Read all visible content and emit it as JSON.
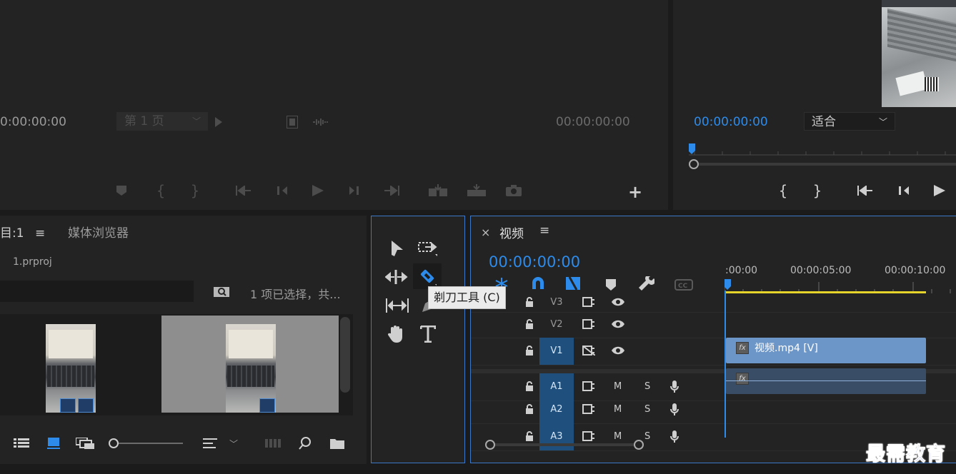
{
  "source_monitor": {
    "timecode_left": "0:00:00:00",
    "page_select": "第 1 页",
    "timecode_right": "00:00:00:00"
  },
  "program_monitor": {
    "timecode": "00:00:00:00",
    "fit_select": "适合"
  },
  "project_panel": {
    "tab_label": "目:1",
    "media_browser_tab": "媒体浏览器",
    "project_file": "1.prproj",
    "search_placeholder": "",
    "selection_status": "1 项已选择，共..."
  },
  "tools": {
    "tooltip": "剃刀工具 (C)"
  },
  "timeline": {
    "tab_label": "视频",
    "timecode": "00:00:00:00",
    "ruler": [
      ":00:00",
      "00:00:05:00",
      "00:00:10:00"
    ],
    "tracks": [
      {
        "name": "V3",
        "kind": "video"
      },
      {
        "name": "V2",
        "kind": "video"
      },
      {
        "name": "V1",
        "kind": "video"
      },
      {
        "name": "A1",
        "kind": "audio"
      },
      {
        "name": "A2",
        "kind": "audio"
      },
      {
        "name": "A3",
        "kind": "audio"
      }
    ],
    "mute_label": "M",
    "solo_label": "S",
    "video_clip_label": "视频.mp4 [V]",
    "fx_label": "fx"
  },
  "watermark": "最需教育",
  "colors": {
    "accent": "#2d8ceb",
    "video_clip": "#6c96c8",
    "audio_clip": "#3a4d66",
    "work_area": "#e6d42a",
    "panel_focus": "#3b78c9"
  }
}
